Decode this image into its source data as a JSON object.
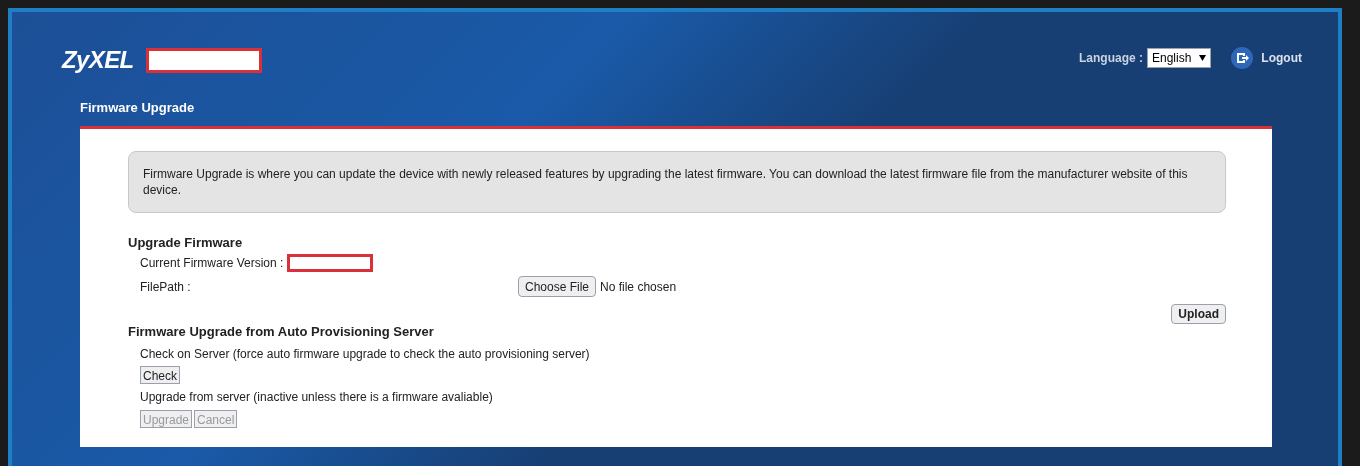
{
  "header": {
    "logo": "ZyXEL",
    "language_label": "Language :",
    "language": "English",
    "logout": "Logout"
  },
  "page_title": "Firmware Upgrade",
  "intro": "Firmware Upgrade is where you can update the device with newly released features by upgrading the latest firmware. You can download the latest firmware file from the manufacturer website of this device.",
  "upgrade_section": {
    "title": "Upgrade Firmware",
    "version_label": "Current Firmware Version :",
    "filepath_label": "FilePath :",
    "choose_button": "Choose File",
    "file_status": "No file chosen",
    "upload_button": "Upload"
  },
  "auto_section": {
    "title": "Firmware Upgrade from Auto Provisioning Server",
    "check_text": "Check on Server (force auto firmware upgrade to check the auto provisioning server)",
    "check_button": {
      "label": "Check",
      "disabled": false
    },
    "upgrade_text": "Upgrade from server (inactive unless there is a firmware avaliable)",
    "buttons": [
      {
        "label": "Upgrade",
        "disabled": true
      },
      {
        "label": "Cancel",
        "disabled": true
      }
    ]
  }
}
